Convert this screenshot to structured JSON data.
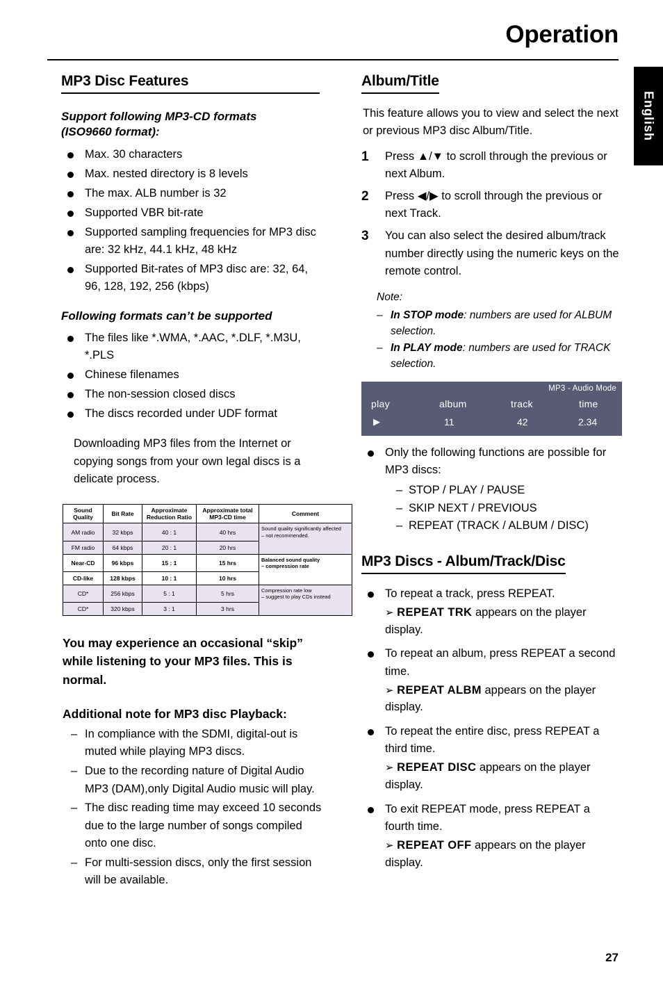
{
  "header": {
    "title": "Operation",
    "language_tab": "English",
    "page_number": "27"
  },
  "left": {
    "section_title": "MP3 Disc Features",
    "sub1_line1": "Support following MP3-CD formats",
    "sub1_line2": "(ISO9660 format):",
    "bullets1": [
      "Max. 30 characters",
      "Max. nested directory is 8 levels",
      "The max. ALB number is 32",
      "Supported VBR bit-rate",
      "Supported sampling frequencies for MP3 disc are: 32 kHz, 44.1 kHz, 48 kHz",
      "Supported Bit-rates of MP3 disc are: 32, 64, 96, 128, 192, 256 (kbps)"
    ],
    "sub2": "Following formats can’t be supported",
    "bullets2": [
      "The files like *.WMA, *.AAC, *.DLF, *.M3U, *.PLS",
      "Chinese filenames",
      "The non-session closed discs",
      "The discs recorded under UDF format"
    ],
    "para1": "Downloading MP3 files from the Internet or copying songs from your own legal discs is a delicate process.",
    "table": {
      "headers": [
        "Sound Quality",
        "Bit Rate",
        "Approximate Reduction Ratio",
        "Approximate total MP3-CD time",
        "Comment"
      ],
      "rows": [
        {
          "quality": "AM radio",
          "rate": "32 kbps",
          "ratio": "40 : 1",
          "time": "40 hrs"
        },
        {
          "quality": "FM radio",
          "rate": "64 kbps",
          "ratio": "20 : 1",
          "time": "20 hrs"
        },
        {
          "quality": "Near-CD",
          "rate": "96 kbps",
          "ratio": "15 : 1",
          "time": "15 hrs"
        },
        {
          "quality": "CD-like",
          "rate": "128 kbps",
          "ratio": "10 : 1",
          "time": "10 hrs"
        },
        {
          "quality": "CD*",
          "rate": "256 kbps",
          "ratio": "5 : 1",
          "time": "5 hrs"
        },
        {
          "quality": "CD*",
          "rate": "320 kbps",
          "ratio": "3 : 1",
          "time": "3 hrs"
        }
      ],
      "comment1_line1": "Sound quality significantly affected",
      "comment1_line2": "– not recommended.",
      "comment2_line1": "Balanced sound quality",
      "comment2_line2": "– compression rate",
      "comment3_line1": "Compression rate low",
      "comment3_line2": "– suggest to play CDs instead"
    },
    "bold_para": "You may experience an occasional “skip” while listening to your MP3 files. This is normal.",
    "sub3": "Additional note for MP3 disc Playback:",
    "dash_notes": [
      "In compliance with the SDMI, digital-out is muted while playing MP3 discs.",
      "Due to the recording nature of Digital Audio MP3 (DAM),only Digital Audio music will play.",
      "The disc reading time may exceed 10 seconds due to the large number of songs compiled onto one disc.",
      "For multi-session discs, only the first session will be available."
    ]
  },
  "right": {
    "section1_title": "Album/Title",
    "intro": "This feature allows you to view and select the next or previous MP3 disc Album/Title.",
    "steps": [
      {
        "num": "1",
        "text": "Press ▲/▼ to scroll through the previous or next Album."
      },
      {
        "num": "2",
        "text": "Press ◀/▶ to scroll through the previous or next Track."
      },
      {
        "num": "3",
        "text": "You can also select the desired album/track number directly using the numeric keys on the remote control."
      }
    ],
    "note": {
      "heading": "Note:",
      "line1_bold": "In STOP mode",
      "line1_rest": ": numbers are used for ALBUM selection.",
      "line2_bold": "In PLAY mode",
      "line2_rest": ": numbers are used for TRACK selection."
    },
    "display": {
      "mode_label": "MP3 - Audio Mode",
      "col_play": "play",
      "col_album": "album",
      "col_track": "track",
      "col_time": "time",
      "play_icon": "▶",
      "album_value": "11",
      "track_value": "42",
      "time_value": "2.34",
      "background_color": "#585b73"
    },
    "functions_bullet": "Only the following functions are possible for MP3 discs:",
    "functions": [
      "STOP / PLAY / PAUSE",
      "SKIP NEXT / PREVIOUS",
      "REPEAT (TRACK / ALBUM / DISC)"
    ],
    "section2_title": "MP3 Discs - Album/Track/Disc",
    "repeat_items": [
      {
        "bullet": "To repeat a track, press REPEAT.",
        "arrow_code": "REPEAT TRK",
        "arrow_rest": "appears on the player display."
      },
      {
        "bullet": "To repeat an album, press REPEAT a second time.",
        "arrow_code": "REPEAT ALBM",
        "arrow_rest": "appears on the player display."
      },
      {
        "bullet": "To repeat the entire disc, press REPEAT a third time.",
        "arrow_code": "REPEAT DISC",
        "arrow_rest": "appears on the player display."
      },
      {
        "bullet": "To exit REPEAT mode, press REPEAT a fourth time.",
        "arrow_code": "REPEAT OFF",
        "arrow_rest": "appears on the player display."
      }
    ]
  }
}
